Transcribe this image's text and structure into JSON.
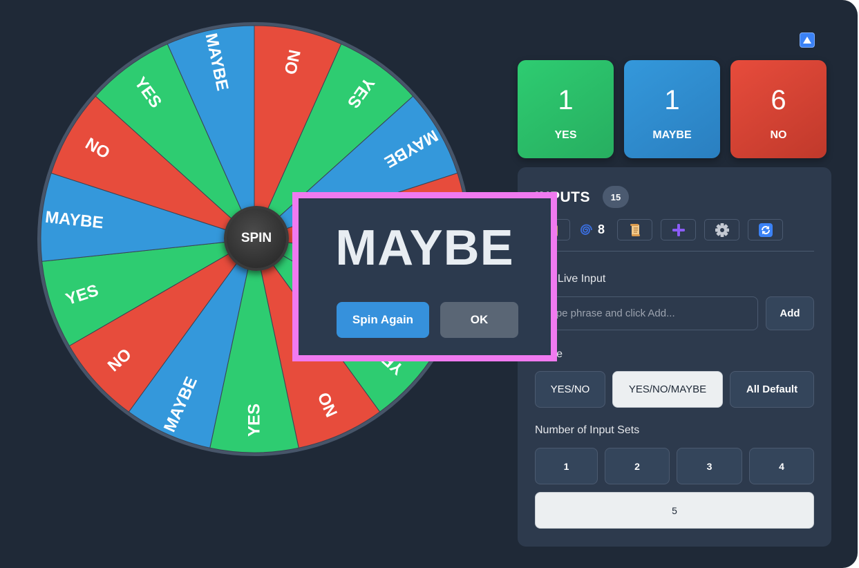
{
  "wheel": {
    "segments": [
      {
        "label": "YES",
        "color": "#2ecc71"
      },
      {
        "label": "MAYBE",
        "color": "#3498db"
      },
      {
        "label": "NO",
        "color": "#e74c3c"
      },
      {
        "label": "YES",
        "color": "#2ecc71"
      },
      {
        "label": "YES",
        "color": "#2ecc71"
      },
      {
        "label": "NO",
        "color": "#e74c3c"
      },
      {
        "label": "YES",
        "color": "#2ecc71"
      },
      {
        "label": "MAYBE",
        "color": "#3498db"
      },
      {
        "label": "NO",
        "color": "#e74c3c"
      },
      {
        "label": "YES",
        "color": "#2ecc71"
      },
      {
        "label": "MAYBE",
        "color": "#3498db"
      },
      {
        "label": "NO",
        "color": "#e74c3c"
      },
      {
        "label": "YES",
        "color": "#2ecc71"
      },
      {
        "label": "MAYBE",
        "color": "#3498db"
      },
      {
        "label": "NO",
        "color": "#e74c3c"
      }
    ],
    "spin_label": "SPIN"
  },
  "collapse_icon": "triangle-up-icon",
  "scores": {
    "yes": {
      "value": "1",
      "label": "YES"
    },
    "maybe": {
      "value": "1",
      "label": "MAYBE"
    },
    "no": {
      "value": "6",
      "label": "NO"
    }
  },
  "panel": {
    "title": "INPUTS",
    "count": "15",
    "tools": {
      "clipboard_icon": "clipboard-icon",
      "spiral_icon": "spiral-icon",
      "spiral_count": "8",
      "scroll_icon": "scroll-icon",
      "plus_icon": "plus-icon",
      "gear_icon": "gear-icon",
      "refresh_icon": "refresh-icon"
    },
    "live_input": {
      "label": "Add Live Input",
      "placeholder": "Type phrase and click Add...",
      "value": "",
      "add_label": "Add"
    },
    "mode": {
      "label": "Mode",
      "options": [
        "YES/NO",
        "YES/NO/MAYBE",
        "All Default"
      ],
      "selected": "YES/NO/MAYBE"
    },
    "input_sets": {
      "label": "Number of Input Sets",
      "options": [
        "1",
        "2",
        "3",
        "4",
        "5"
      ],
      "selected": "5"
    }
  },
  "modal": {
    "result": "MAYBE",
    "spin_again_label": "Spin Again",
    "ok_label": "OK"
  }
}
